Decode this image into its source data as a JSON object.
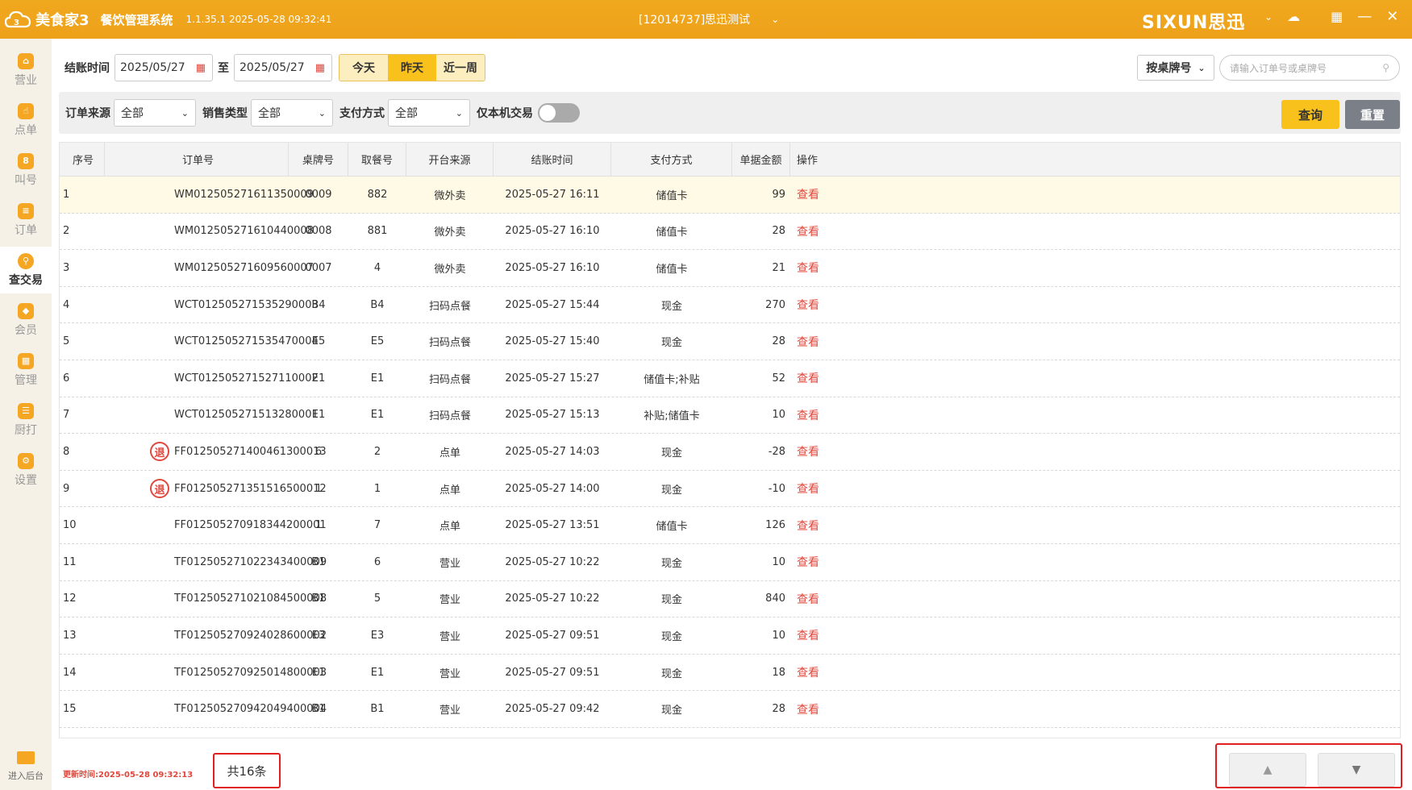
{
  "titlebar": {
    "app_name": "美食家3",
    "system_name": "餐饮管理系统",
    "version_time": "1.1.35.1 2025-05-28 09:32:41",
    "store": "[12014737]思迅测试",
    "brand": "SIXUN思迅"
  },
  "sidebar": {
    "items": [
      {
        "label": "营业",
        "icon": "store-icon"
      },
      {
        "label": "点单",
        "icon": "hand-icon"
      },
      {
        "label": "叫号",
        "icon": "number-icon"
      },
      {
        "label": "订单",
        "icon": "list-icon"
      },
      {
        "label": "查交易",
        "icon": "search-icon",
        "active": true
      },
      {
        "label": "会员",
        "icon": "diamond-icon"
      },
      {
        "label": "管理",
        "icon": "grid-icon"
      },
      {
        "label": "厨打",
        "icon": "printer-icon"
      },
      {
        "label": "设置",
        "icon": "gear-icon"
      }
    ],
    "backend_label": "进入后台"
  },
  "filters": {
    "settle_time_label": "结账时间",
    "date_from": "2025/05/27",
    "to_label": "至",
    "date_to": "2025/05/27",
    "quick": [
      "今天",
      "昨天",
      "近一周"
    ],
    "quick_selected": "昨天",
    "search_by": "按桌牌号",
    "search_placeholder": "请输入订单号或桌牌号",
    "order_source_label": "订单来源",
    "order_source_value": "全部",
    "sale_type_label": "销售类型",
    "sale_type_value": "全部",
    "pay_method_label": "支付方式",
    "pay_method_value": "全部",
    "local_only_label": "仅本机交易",
    "query_btn": "查询",
    "reset_btn": "重置"
  },
  "table": {
    "headers": [
      "序号",
      "订单号",
      "桌牌号",
      "取餐号",
      "开台来源",
      "结账时间",
      "支付方式",
      "单据金额",
      "操作"
    ],
    "rows": [
      {
        "idx": "1",
        "no": "WM012505271611350009",
        "table": "0009",
        "pick": "882",
        "source": "微外卖",
        "time": "2025-05-27 16:11",
        "pay": "储值卡",
        "amount": "99",
        "op": "查看",
        "refund": false
      },
      {
        "idx": "2",
        "no": "WM012505271610440008",
        "table": "0008",
        "pick": "881",
        "source": "微外卖",
        "time": "2025-05-27 16:10",
        "pay": "储值卡",
        "amount": "28",
        "op": "查看",
        "refund": false
      },
      {
        "idx": "3",
        "no": "WM012505271609560007",
        "table": "0007",
        "pick": "4",
        "source": "微外卖",
        "time": "2025-05-27 16:10",
        "pay": "储值卡",
        "amount": "21",
        "op": "查看",
        "refund": false
      },
      {
        "idx": "4",
        "no": "WCT012505271535290003",
        "table": "B4",
        "pick": "B4",
        "source": "扫码点餐",
        "time": "2025-05-27 15:44",
        "pay": "现金",
        "amount": "270",
        "op": "查看",
        "refund": false
      },
      {
        "idx": "5",
        "no": "WCT012505271535470004",
        "table": "E5",
        "pick": "E5",
        "source": "扫码点餐",
        "time": "2025-05-27 15:40",
        "pay": "现金",
        "amount": "28",
        "op": "查看",
        "refund": false
      },
      {
        "idx": "6",
        "no": "WCT012505271527110002",
        "table": "E1",
        "pick": "E1",
        "source": "扫码点餐",
        "time": "2025-05-27 15:27",
        "pay": "储值卡;补贴",
        "amount": "52",
        "op": "查看",
        "refund": false
      },
      {
        "idx": "7",
        "no": "WCT012505271513280001",
        "table": "E1",
        "pick": "E1",
        "source": "扫码点餐",
        "time": "2025-05-27 15:13",
        "pay": "补贴;储值卡",
        "amount": "10",
        "op": "查看",
        "refund": false
      },
      {
        "idx": "8",
        "no": "FF012505271400461300013",
        "table": "6",
        "pick": "2",
        "source": "点单",
        "time": "2025-05-27 14:03",
        "pay": "现金",
        "amount": "-28",
        "op": "查看",
        "refund": true,
        "refund_label": "退"
      },
      {
        "idx": "9",
        "no": "FF012505271351516500012",
        "table": "1",
        "pick": "1",
        "source": "点单",
        "time": "2025-05-27 14:00",
        "pay": "现金",
        "amount": "-10",
        "op": "查看",
        "refund": true,
        "refund_label": "退"
      },
      {
        "idx": "10",
        "no": "FF012505270918344200001",
        "table": "1",
        "pick": "7",
        "source": "点单",
        "time": "2025-05-27 13:51",
        "pay": "储值卡",
        "amount": "126",
        "op": "查看",
        "refund": false
      },
      {
        "idx": "11",
        "no": "TF012505271022343400009",
        "table": "B1",
        "pick": "6",
        "source": "营业",
        "time": "2025-05-27 10:22",
        "pay": "现金",
        "amount": "10",
        "op": "查看",
        "refund": false
      },
      {
        "idx": "12",
        "no": "TF012505271021084500008",
        "table": "B1",
        "pick": "5",
        "source": "营业",
        "time": "2025-05-27 10:22",
        "pay": "现金",
        "amount": "840",
        "op": "查看",
        "refund": false
      },
      {
        "idx": "13",
        "no": "TF012505270924028600002",
        "table": "E3",
        "pick": "E3",
        "source": "营业",
        "time": "2025-05-27 09:51",
        "pay": "现金",
        "amount": "10",
        "op": "查看",
        "refund": false
      },
      {
        "idx": "14",
        "no": "TF012505270925014800003",
        "table": "E1",
        "pick": "E1",
        "source": "营业",
        "time": "2025-05-27 09:51",
        "pay": "现金",
        "amount": "18",
        "op": "查看",
        "refund": false
      },
      {
        "idx": "15",
        "no": "TF012505270942049400004",
        "table": "B1",
        "pick": "B1",
        "source": "营业",
        "time": "2025-05-27 09:42",
        "pay": "现金",
        "amount": "28",
        "op": "查看",
        "refund": false
      }
    ]
  },
  "footer": {
    "update_time": "更新时间:2025-05-28 09:32:13",
    "total": "共16条"
  },
  "colors": {
    "accent": "#f5a623",
    "selected": "#f8c11c",
    "danger": "#e0483e",
    "reset": "#7a7f88"
  }
}
